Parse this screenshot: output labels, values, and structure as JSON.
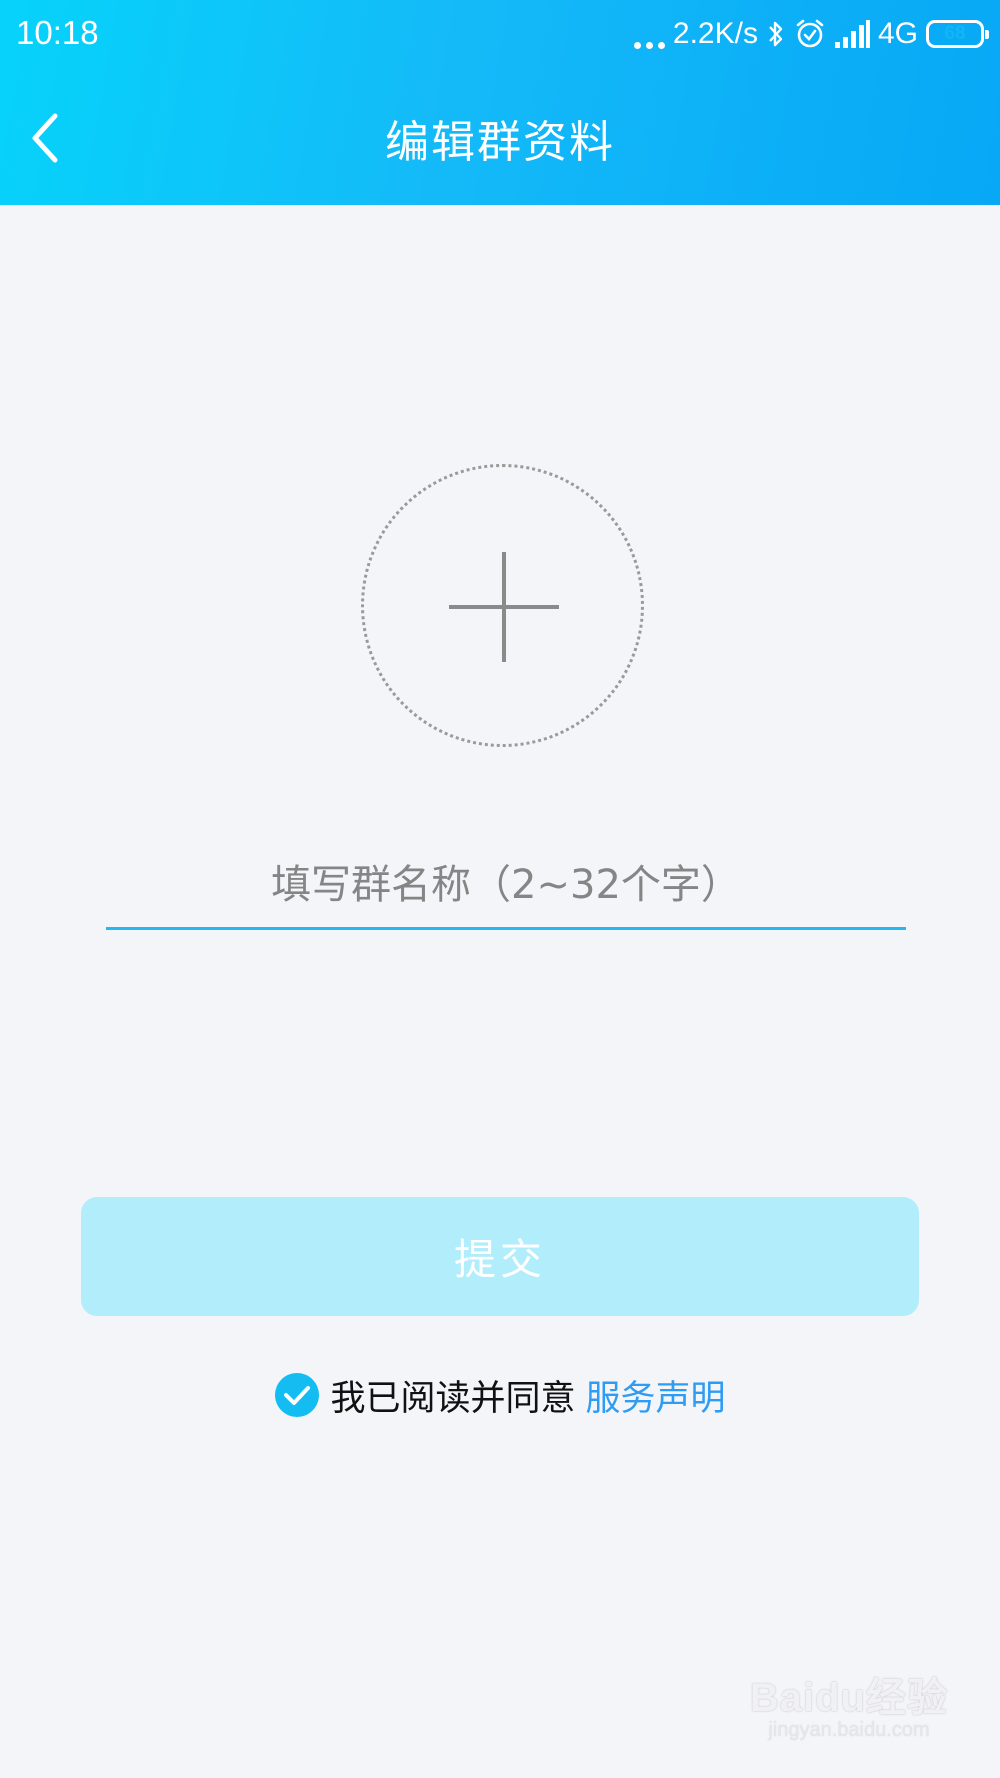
{
  "status_bar": {
    "time": "10:18",
    "network_speed": "2.2K/s",
    "network_type": "4G",
    "battery_level": "68",
    "battery_fraction": 0.68,
    "icons": [
      "more-dots-icon",
      "bluetooth-icon",
      "alarm-icon",
      "signal-icon",
      "battery-icon"
    ]
  },
  "header": {
    "title": "编辑群资料",
    "back_icon": "chevron-left-icon"
  },
  "avatar": {
    "icon": "plus-icon"
  },
  "group_name": {
    "value": "",
    "placeholder": "填写群名称（2~32个字）"
  },
  "submit": {
    "label": "提交"
  },
  "agreement": {
    "checked": true,
    "text": "我已阅读并同意",
    "link": "服务声明"
  },
  "watermark": {
    "logo": "Baidu经验",
    "url": "jingyan.baidu.com"
  },
  "colors": {
    "header_start": "#06d3fb",
    "header_end": "#07a8f6",
    "accent": "#22b8f0",
    "link": "#2f9cf4",
    "button_disabled": "#b2edfc",
    "background": "#f4f5f9"
  }
}
